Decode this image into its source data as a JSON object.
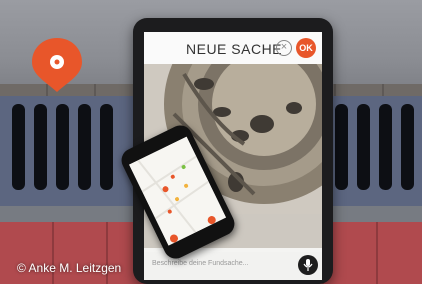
{
  "app": {
    "screen_title": "NEUE SACHE",
    "ok_label": "OK",
    "cancel_symbol": "×",
    "description_placeholder": "Beschreibe deine Fundsache...",
    "mic_icon": "microphone-icon",
    "accent_color": "#e8562a"
  },
  "credit": "© Anke M. Leitzgen"
}
